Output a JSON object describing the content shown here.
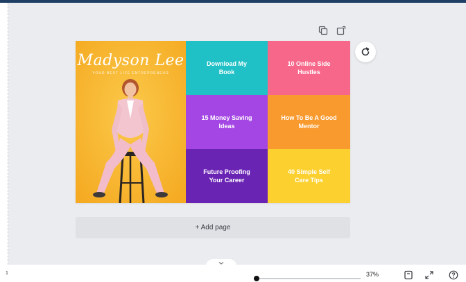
{
  "design": {
    "hero": {
      "name": "Madyson Lee",
      "subtitle": "YOUR BEST LIFE ENTREPRENEUR"
    },
    "tiles": [
      {
        "label": "Download My Book",
        "color": "#1fc1c6"
      },
      {
        "label": "10 Online Side Hustles",
        "color": "#f7678a"
      },
      {
        "label": "15 Money Saving Ideas",
        "color": "#a446e3"
      },
      {
        "label": "How To Be A Good Mentor",
        "color": "#f99a2f"
      },
      {
        "label": "Future Proofing Your Career",
        "color": "#6a24b4"
      },
      {
        "label": "40 Simple Self Care Tips",
        "color": "#fcd02e"
      }
    ]
  },
  "canvas": {
    "add_page_label": "+ Add page"
  },
  "footer": {
    "notes_label": "1",
    "zoom_label": "37%",
    "zoom_fraction": 0.0
  },
  "colors": {
    "header": "#1f3e63",
    "canvas_bg": "#ebecf0",
    "hero_bg": "#f9b934"
  },
  "icons": [
    "duplicate-page-icon",
    "add-page-icon",
    "refresh-icon",
    "chevron-down-icon",
    "page-grid-icon",
    "fullscreen-icon",
    "help-icon"
  ]
}
